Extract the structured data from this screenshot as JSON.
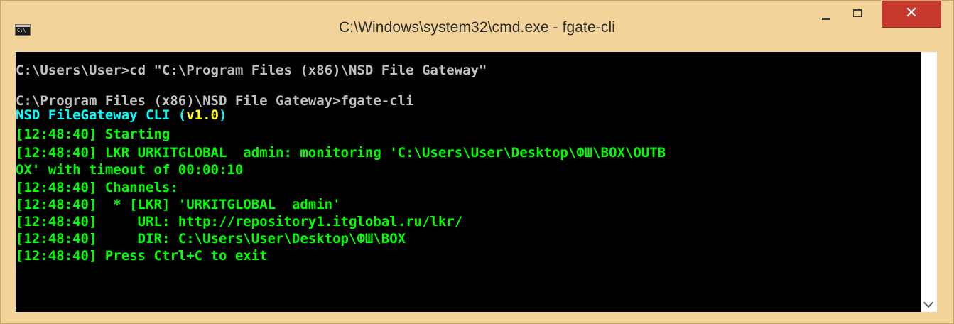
{
  "window": {
    "title": "C:\\Windows\\system32\\cmd.exe - fgate-cli",
    "app_icon_text": "C:\\",
    "close_glyph": "✕",
    "colors": {
      "frame": "#f2d399",
      "close": "#c7392c",
      "console_bg": "#000000"
    }
  },
  "console": {
    "lines": {
      "l1": "C:\\Users\\User>cd \"C:\\Program Files (x86)\\NSD File Gateway\"",
      "l2": "C:\\Program Files (x86)\\NSD File Gateway>fgate-cli",
      "l3_name": "NSD FileGateway CLI (",
      "l3_version": "v1.0",
      "l3_end": ")",
      "l4": "[12:48:40] Starting",
      "l5": "[12:48:40] LKR URKITGLOBAL  admin: monitoring 'C:\\Users\\User\\Desktop\\ФШ\\BOX\\OUTB",
      "l6": "OX' with timeout of 00:00:10",
      "l7": "[12:48:40] Channels:",
      "l8": "[12:48:40]  * [LKR] 'URKITGLOBAL  admin'",
      "l9": "[12:48:40]     URL: http://repository1.itglobal.ru/lkr/",
      "l10": "[12:48:40]     DIR: C:\\Users\\User\\Desktop\\ФШ\\BOX",
      "l11": "[12:48:40] Press Ctrl+C to exit"
    },
    "colors": {
      "prompt": "#c0c0c0",
      "cli_name": "#00ffff",
      "version": "#ffff00",
      "log": "#00ff00"
    }
  },
  "scrollbar": {
    "icon": "chevron-down-icon"
  }
}
